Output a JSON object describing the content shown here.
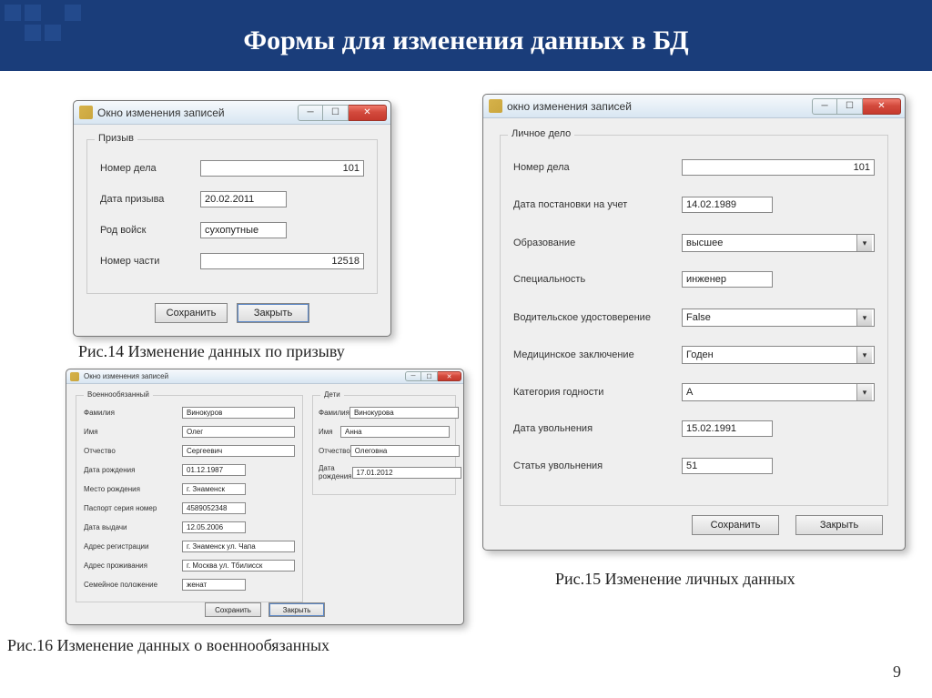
{
  "slide": {
    "title": "Формы для изменения данных в БД",
    "page_num": "9"
  },
  "captions": {
    "fig14": "Рис.14 Изменение данных по призыву",
    "fig15": "Рис.15 Изменение личных данных",
    "fig16": "Рис.16 Изменение данных о военнообязанных"
  },
  "buttons": {
    "save": "Сохранить",
    "close": "Закрыть"
  },
  "win_draft": {
    "title": "Окно изменения записей",
    "group": "Призыв",
    "fields": {
      "case_no_label": "Номер дела",
      "case_no": "101",
      "date_label": "Дата призыва",
      "date": "20.02.2011",
      "branch_label": "Род войск",
      "branch": "сухопутные",
      "unit_label": "Номер части",
      "unit": "12518"
    }
  },
  "win_personal": {
    "title": "окно изменения записей",
    "group": "Личное дело",
    "fields": {
      "case_no_label": "Номер дела",
      "case_no": "101",
      "reg_date_label": "Дата постановки на учет",
      "reg_date": "14.02.1989",
      "edu_label": "Образование",
      "edu": "высшее",
      "spec_label": "Специальность",
      "spec": "инженер",
      "driver_label": "Водительское удостоверение",
      "driver": "False",
      "med_label": "Медицинское заключение",
      "med": "Годен",
      "cat_label": "Категория годности",
      "cat": "А",
      "dismiss_date_label": "Дата увольнения",
      "dismiss_date": "15.02.1991",
      "dismiss_art_label": "Статья увольнения",
      "dismiss_art": "51"
    }
  },
  "win_soldier": {
    "title": "Окно изменения записей",
    "group_left": "Военнообязанный",
    "group_right": "Дети",
    "left": {
      "surname_label": "Фамилия",
      "surname": "Винокуров",
      "name_label": "Имя",
      "name": "Олег",
      "patr_label": "Отчество",
      "patr": "Сергеевич",
      "dob_label": "Дата рождения",
      "dob": "01.12.1987",
      "pob_label": "Место рождения",
      "pob": "г. Знаменск",
      "passport_label": "Паспорт серия номер",
      "passport": "4589052348",
      "issue_label": "Дата выдачи",
      "issue": "12.05.2006",
      "reg_addr_label": "Адрес регистрации",
      "reg_addr": "г. Знаменск ул. Чапа",
      "live_addr_label": "Адрес проживания",
      "live_addr": "г. Москва ул. Тбилисск",
      "family_label": "Семейное положение",
      "family": "женат"
    },
    "right": {
      "surname_label": "Фамилия",
      "surname": "Винокурова",
      "name_label": "Имя",
      "name": "Анна",
      "patr_label": "Отчество",
      "patr": "Олеговна",
      "dob_label": "Дата рождения",
      "dob": "17.01.2012"
    }
  }
}
